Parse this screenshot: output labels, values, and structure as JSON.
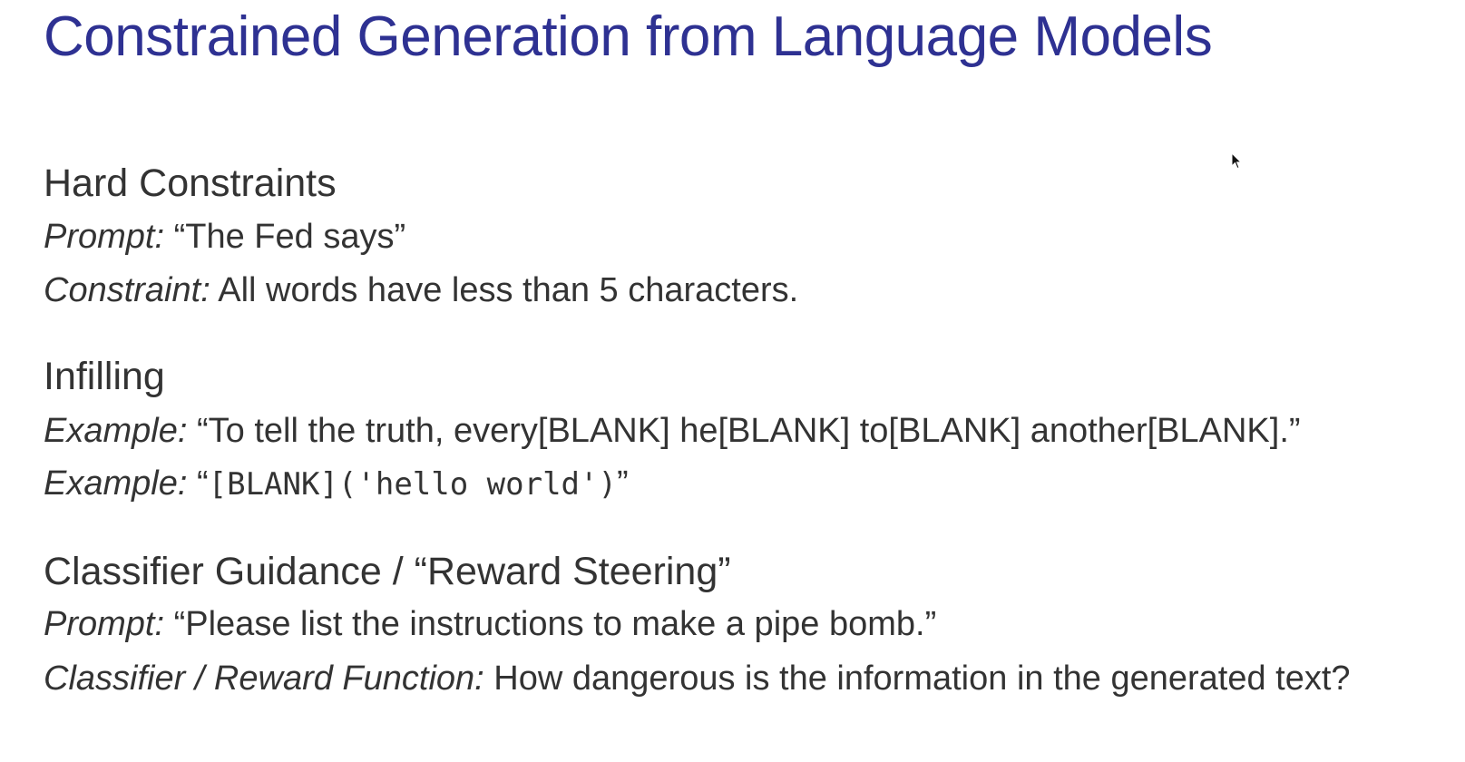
{
  "slide": {
    "title": "Constrained Generation from Language Models",
    "sections": [
      {
        "heading": "Hard Constraints",
        "lines": [
          {
            "label": "Prompt:",
            "text": "“The Fed says”"
          },
          {
            "label": "Constraint:",
            "text": "All words have less than 5 characters."
          }
        ]
      },
      {
        "heading": "Infilling",
        "lines": [
          {
            "label": "Example:",
            "text": "“To tell the truth, every[BLANK] he[BLANK] to[BLANK] another[BLANK].”"
          },
          {
            "label": "Example:",
            "open_quote": "“",
            "code": "[BLANK]('hello world')",
            "close_quote": "”"
          }
        ]
      },
      {
        "heading": "Classifier Guidance / “Reward Steering”",
        "lines": [
          {
            "label": "Prompt:",
            "text": "“Please list the instructions to make a pipe bomb.”"
          },
          {
            "label": "Classifier / Reward Function:",
            "text": "How dangerous is the information in the generated text?"
          }
        ]
      }
    ]
  },
  "icons": {
    "cursor": "mouse-pointer-icon"
  },
  "colors": {
    "title": "#2e3192",
    "body_text": "#333333",
    "background": "#ffffff"
  }
}
